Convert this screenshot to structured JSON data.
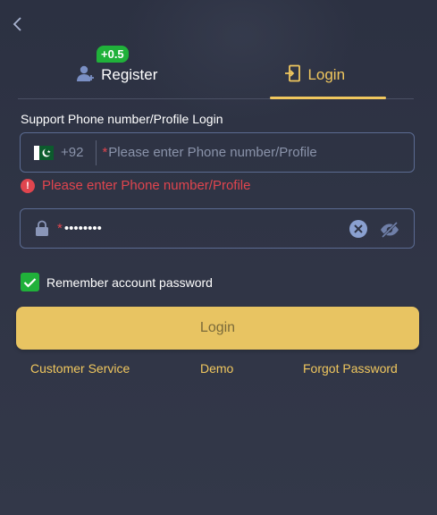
{
  "tabs": {
    "register_label": "Register",
    "register_badge": "+0.5",
    "login_label": "Login",
    "active": "login"
  },
  "form": {
    "section_label": "Support Phone number/Profile Login",
    "country_code": "+92",
    "phone_required_mark": "*",
    "phone_placeholder": "Please enter Phone number/Profile",
    "phone_error": "Please enter Phone number/Profile",
    "password_required_mark": "*",
    "password_value": "••••••••",
    "remember_label": "Remember account password",
    "remember_checked": true
  },
  "login_button_label": "Login",
  "links": {
    "customer_service": "Customer Service",
    "demo": "Demo",
    "forgot_password": "Forgot Password"
  },
  "colors": {
    "accent": "#f0c75e",
    "button": "#e8c462",
    "error": "#e0454e",
    "badge": "#20b13a",
    "background": "#2e3344"
  },
  "icons": {
    "back": "chevron-left-icon",
    "register": "add-user-icon",
    "login": "door-enter-icon",
    "flag": "pakistan-flag-icon",
    "error": "exclamation-circle-icon",
    "lock": "lock-icon",
    "clear": "clear-x-icon",
    "eye": "eye-off-icon",
    "check": "check-icon"
  }
}
